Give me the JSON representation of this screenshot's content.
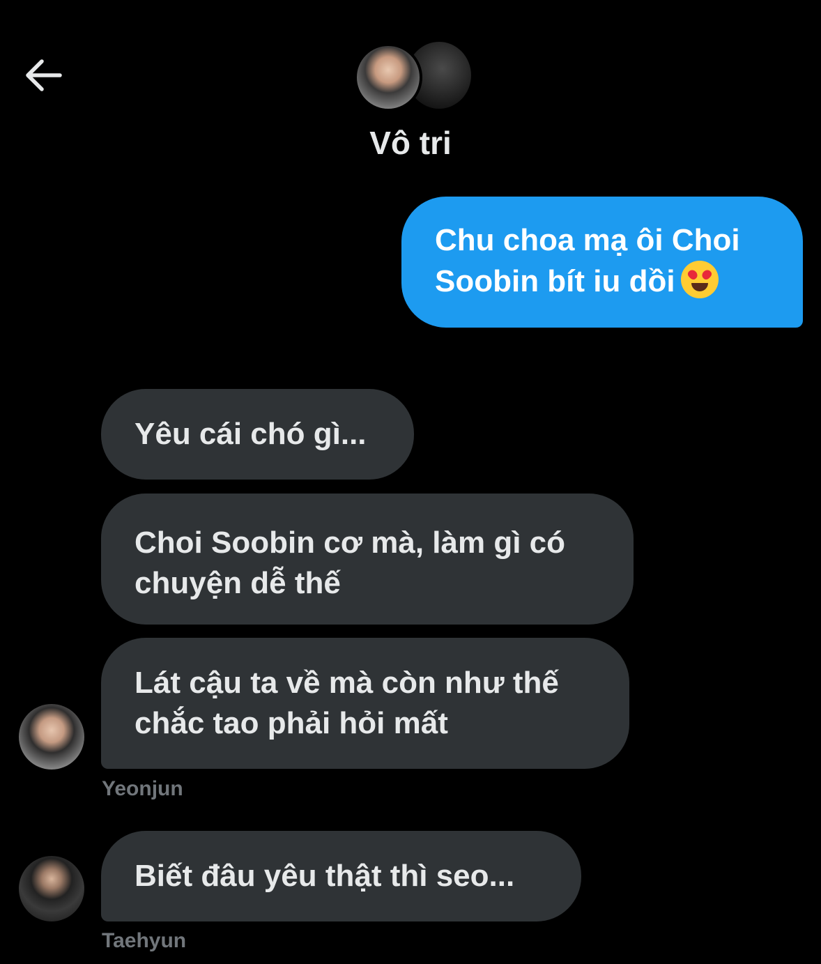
{
  "header": {
    "title": "Vô tri",
    "back_icon": "arrow-left-icon"
  },
  "messages": [
    {
      "direction": "outgoing",
      "lines": [
        "Chu choa mạ ôi Choi",
        "Soobin bít iu dồi"
      ],
      "emoji": "heart-eyes-emoji"
    },
    {
      "direction": "incoming",
      "lines": [
        "Yêu cái chó gì..."
      ]
    },
    {
      "direction": "incoming",
      "lines": [
        "Choi Soobin cơ mà, làm gì có",
        "chuyện dễ thế"
      ]
    },
    {
      "direction": "incoming",
      "lines": [
        "Lát cậu ta về mà còn như thế",
        "chắc tao phải hỏi mất"
      ],
      "sender": "Yeonjun"
    },
    {
      "direction": "incoming",
      "lines": [
        "Biết đâu yêu thật thì seo..."
      ],
      "sender": "Taehyun"
    }
  ],
  "colors": {
    "background": "#000000",
    "outgoing_bubble": "#1d9bf0",
    "incoming_bubble": "#2f3336",
    "sender_name": "#71767b"
  }
}
